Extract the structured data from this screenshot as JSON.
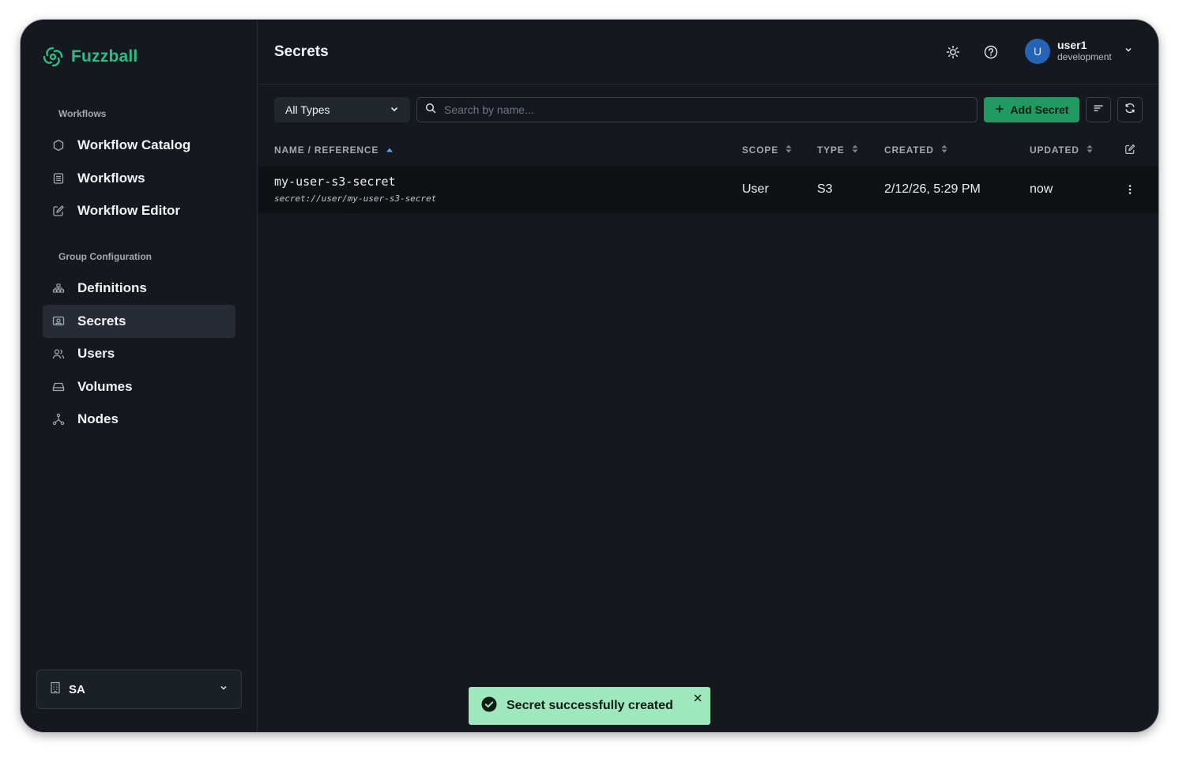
{
  "app": {
    "name": "Fuzzball",
    "brand_color": "#2ebd86"
  },
  "sidebar": {
    "sections": [
      {
        "title": "Workflows",
        "items": [
          {
            "label": "Workflow Catalog",
            "icon": "hexagon-icon"
          },
          {
            "label": "Workflows",
            "icon": "document-list-icon"
          },
          {
            "label": "Workflow Editor",
            "icon": "edit-icon"
          }
        ]
      },
      {
        "title": "Group Configuration",
        "items": [
          {
            "label": "Definitions",
            "icon": "sitemap-icon"
          },
          {
            "label": "Secrets",
            "icon": "key-card-icon",
            "active": true
          },
          {
            "label": "Users",
            "icon": "users-icon"
          },
          {
            "label": "Volumes",
            "icon": "drive-icon"
          },
          {
            "label": "Nodes",
            "icon": "nodes-icon"
          }
        ]
      }
    ],
    "org_select": {
      "label": "SA"
    }
  },
  "header": {
    "title": "Secrets",
    "user": {
      "initial": "U",
      "name": "user1",
      "env": "development"
    }
  },
  "toolbar": {
    "type_filter": "All Types",
    "search_placeholder": "Search by name...",
    "add_label": "Add Secret"
  },
  "table": {
    "columns": {
      "name": "NAME / REFERENCE",
      "scope": "SCOPE",
      "type": "TYPE",
      "created": "CREATED",
      "updated": "UPDATED"
    },
    "rows": [
      {
        "name": "my-user-s3-secret",
        "reference": "secret://user/my-user-s3-secret",
        "scope": "User",
        "type": "S3",
        "created": "2/12/26, 5:29 PM",
        "updated": "now"
      }
    ]
  },
  "toast": {
    "message": "Secret successfully created",
    "color": "#9fe7bd"
  }
}
